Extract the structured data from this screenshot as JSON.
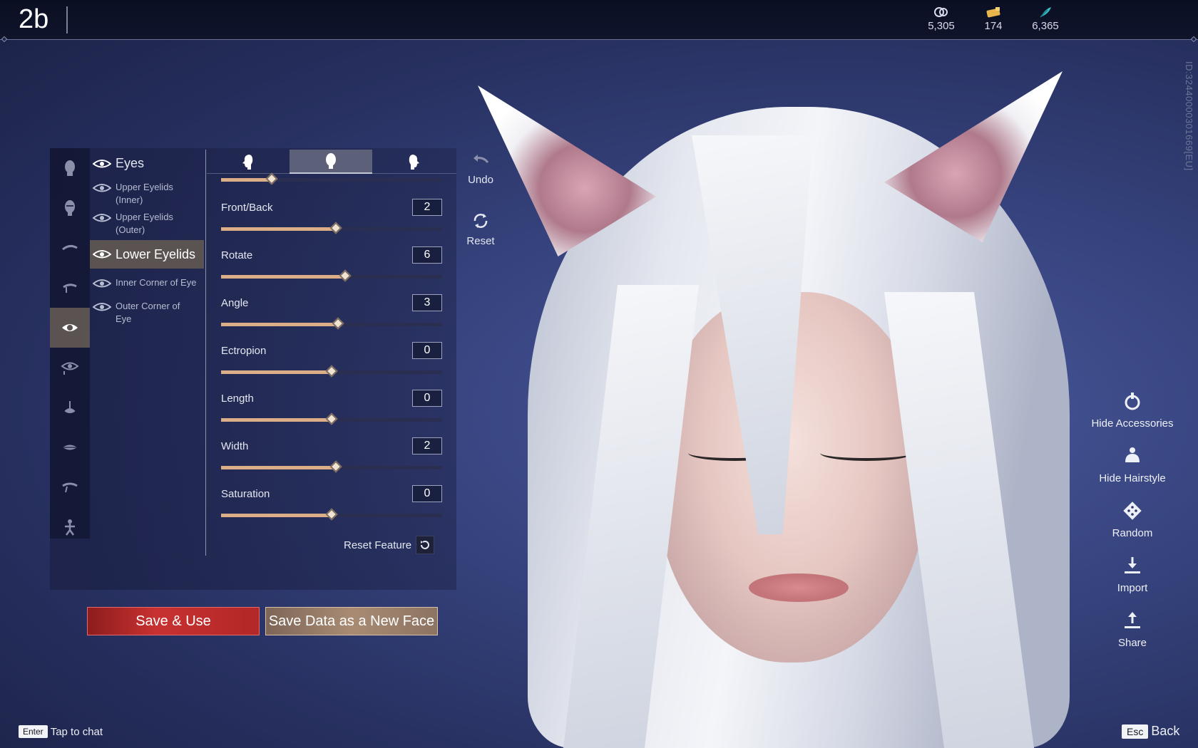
{
  "header": {
    "title": "2b",
    "currencies": [
      {
        "icon": "spiral-token-icon",
        "value": "5,305"
      },
      {
        "icon": "ticket-icon",
        "value": "174"
      },
      {
        "icon": "feather-icon",
        "value": "6,365"
      }
    ]
  },
  "player_id": "ID:32440000301669[EU]",
  "sub_features": [
    {
      "label": "Eyes"
    },
    {
      "label": "Upper Eyelids (Inner)"
    },
    {
      "label": "Upper Eyelids (Outer)"
    },
    {
      "label": "Lower Eyelids"
    },
    {
      "label": "Inner Corner of Eye"
    },
    {
      "label": "Outer Corner of Eye"
    }
  ],
  "active_sub_feature": "Lower Eyelids",
  "sliders": [
    {
      "label": "Front/Back",
      "value": "2",
      "position": 0.52
    },
    {
      "label": "Rotate",
      "value": "6",
      "position": 0.56
    },
    {
      "label": "Angle",
      "value": "3",
      "position": 0.53
    },
    {
      "label": "Ectropion",
      "value": "0",
      "position": 0.5
    },
    {
      "label": "Length",
      "value": "0",
      "position": 0.5
    },
    {
      "label": "Width",
      "value": "2",
      "position": 0.52
    },
    {
      "label": "Saturation",
      "value": "0",
      "position": 0.5
    }
  ],
  "partial_slider_position": 0.23,
  "reset_feature_label": "Reset Feature",
  "tools": {
    "undo": "Undo",
    "reset": "Reset"
  },
  "buttons": {
    "save_use": "Save & Use",
    "save_new": "Save Data as a New Face"
  },
  "right_tools": [
    {
      "icon": "hide-accessories-icon",
      "label": "Hide Accessories"
    },
    {
      "icon": "hide-hairstyle-icon",
      "label": "Hide Hairstyle"
    },
    {
      "icon": "random-dice-icon",
      "label": "Random"
    },
    {
      "icon": "import-icon",
      "label": "Import"
    },
    {
      "icon": "share-icon",
      "label": "Share"
    }
  ],
  "hints": {
    "chat_key": "Enter",
    "chat_label": "Tap to chat",
    "back_key": "Esc",
    "back_label": "Back"
  },
  "colors": {
    "slider_fill": "#dcae88",
    "save_use": "#c83131",
    "save_new": "#a98b73",
    "active_item": "#5b5352"
  }
}
